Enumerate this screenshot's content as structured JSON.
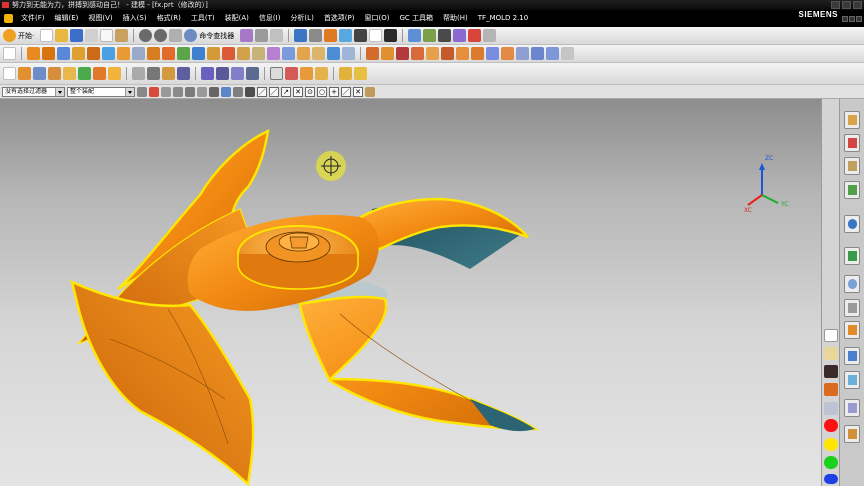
{
  "window": {
    "title": "努力到无能为力，拼搏到感动自己！ - 建模 - [fx.prt（修改的）]"
  },
  "menubar": {
    "items": [
      "文件(F)",
      "编辑(E)",
      "视图(V)",
      "插入(S)",
      "格式(R)",
      "工具(T)",
      "装配(A)",
      "信息(I)",
      "分析(L)",
      "首选项(P)",
      "窗口(O)",
      "GC 工具箱",
      "帮助(H)",
      "TF_MOLD 2.10"
    ],
    "brand": "SIEMENS"
  },
  "toolbar_standard": {
    "start_label": "开始·",
    "command_finder_label": "命令查找器"
  },
  "selection_bar": {
    "filter_value": "没有选择过滤器",
    "scope_value": "整个装配"
  },
  "view_triad": {
    "zc_label": "ZC",
    "yc_label": "YC",
    "xc_label": "XC",
    "zc_color": "#1a56d6",
    "yc_color": "#1bae2b",
    "xc_color": "#e0241b"
  },
  "colors": {
    "part_orange": "#f28a12",
    "edge_highlight": "#ffe600",
    "hub_shadow": "#2a5a6a",
    "cursor_yellow": "#e5e23a"
  },
  "right_palette": {
    "swatches": [
      "#ff1010",
      "#ffe600",
      "#1bd11b",
      "#1e3ee6"
    ]
  },
  "icons": {
    "app": "nx-app-icon",
    "cursor": "crosshair-cursor-icon"
  }
}
